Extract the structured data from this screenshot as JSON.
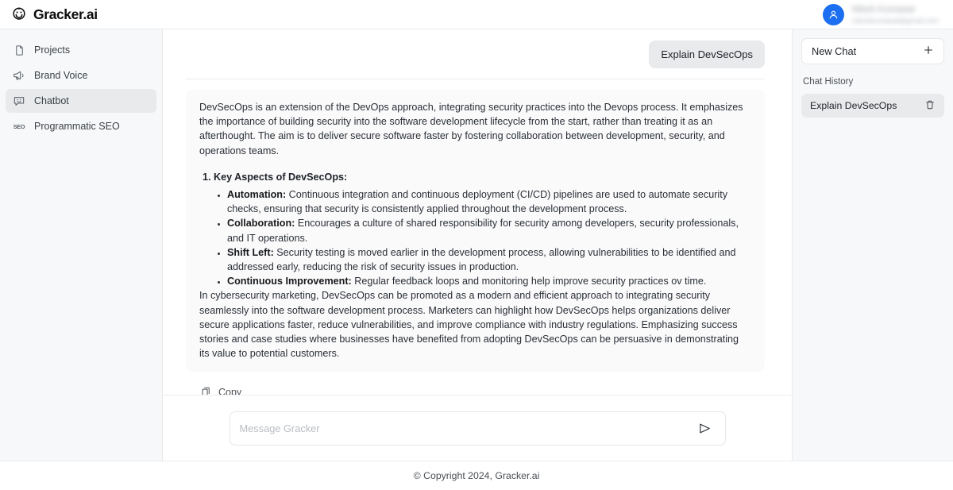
{
  "brand": {
    "name": "Gracker.ai",
    "logo_icon": "smiley-shield-logo"
  },
  "user": {
    "name": "Nilesh Kumawat",
    "email": "nileshkumawat@gmail.com",
    "avatar_icon": "user-icon",
    "avatar_color": "#1b6ff0"
  },
  "sidebar": {
    "items": [
      {
        "label": "Projects",
        "icon": "file-icon",
        "active": false
      },
      {
        "label": "Brand Voice",
        "icon": "megaphone-icon",
        "active": false
      },
      {
        "label": "Chatbot",
        "icon": "chat-smiley-icon",
        "active": true
      },
      {
        "label": "Programmatic SEO",
        "icon": "seo-icon",
        "active": false
      }
    ]
  },
  "chat": {
    "user_message": "Explain DevSecOps",
    "assistant": {
      "intro": "DevSecOps is an extension of the DevOps approach, integrating security practices into the Devops process. It emphasizes the importance of building security into the software development lifecycle from the start, rather than treating it as an afterthought. The aim is to deliver secure software faster by fostering collaboration between development, security, and operations teams.",
      "list_title": "Key Aspects of DevSecOps:",
      "aspects": [
        {
          "lead": "Automation:",
          "text": " Continuous integration and continuous deployment (CI/CD) pipelines are used to automate security checks, ensuring that security is consistently applied throughout the development process."
        },
        {
          "lead": "Collaboration:",
          "text": " Encourages a culture of shared responsibility for security among developers, security professionals, and IT operations."
        },
        {
          "lead": "Shift Left:",
          "text": " Security testing is moved earlier in the development process, allowing vulnerabilities to be identified and addressed early, reducing the risk of security issues in production."
        },
        {
          "lead": "Continuous Improvement:",
          "text": " Regular feedback loops and monitoring help improve security practices ov time."
        }
      ],
      "outro": "In cybersecurity marketing, DevSecOps can be promoted as a modern and efficient approach to integrating security seamlessly into the software development process. Marketers can highlight how DevSecOps helps organizations deliver secure applications faster, reduce vulnerabilities, and improve compliance with industry regulations. Emphasizing success stories and case studies where businesses have benefited from adopting DevSecOps can be persuasive in demonstrating its value to potential customers."
    },
    "copy_label": "Copy",
    "copy_icon": "copy-icon"
  },
  "composer": {
    "value": "",
    "placeholder": "Message Gracker",
    "send_icon": "send-icon"
  },
  "right_panel": {
    "new_chat_label": "New Chat",
    "new_chat_icon": "plus-icon",
    "history_label": "Chat History",
    "history_items": [
      {
        "label": "Explain DevSecOps",
        "delete_icon": "trash-icon",
        "active": true
      }
    ]
  },
  "footer": {
    "copyright": "© Copyright 2024, Gracker.ai"
  }
}
